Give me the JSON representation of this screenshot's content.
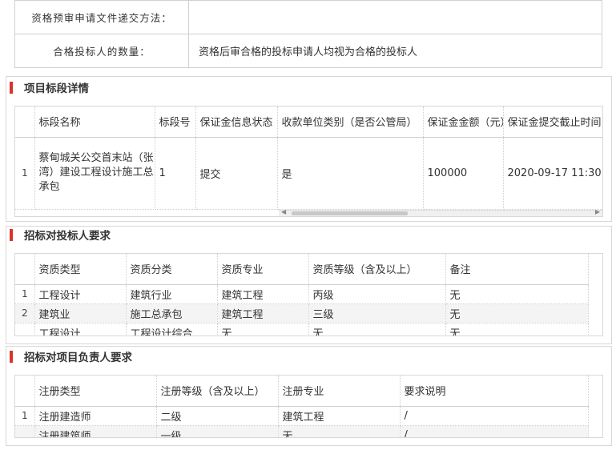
{
  "top": {
    "row1_label": "资格预审申请文件递交方法：",
    "row1_value": "",
    "row2_label": "合格投标人的数量：",
    "row2_value": "资格后审合格的投标申请人均视为合格的投标人"
  },
  "sections": {
    "segment_title": "项目标段详情",
    "bidder_title": "招标对投标人要求",
    "manager_title": "招标对项目负责人要求"
  },
  "segment": {
    "headers": [
      "标段名称",
      "标段号",
      "保证金信息状态",
      "收款单位类别（是否公管局）",
      "保证金金额（元）",
      "保证金提交截止时间"
    ],
    "rows": [
      {
        "num": "1",
        "name": "蔡甸城关公交首末站（张湾）建设工程设计施工总承包",
        "code": "1",
        "status": "提交",
        "category": "是",
        "amount": "100000",
        "deadline": "2020-09-17 11:30"
      }
    ]
  },
  "bidder": {
    "headers": [
      "资质类型",
      "资质分类",
      "资质专业",
      "资质等级（含及以上）",
      "备注"
    ],
    "rows": [
      {
        "num": "1",
        "type": "工程设计",
        "class": "建筑行业",
        "major": "建筑工程",
        "level": "丙级",
        "note": "无"
      },
      {
        "num": "2",
        "type": "建筑业",
        "class": "施工总承包",
        "major": "建筑工程",
        "level": "三级",
        "note": "无"
      },
      {
        "num": "",
        "type": "工程设计",
        "class": "工程设计综合",
        "major": "无",
        "level": "无",
        "note": "无"
      }
    ]
  },
  "manager": {
    "headers": [
      "注册类型",
      "注册等级（含及以上）",
      "注册专业",
      "要求说明"
    ],
    "rows": [
      {
        "num": "1",
        "type": "注册建造师",
        "level": "二级",
        "major": "建筑工程",
        "note": "/"
      },
      {
        "num": "",
        "type": "注册建筑师",
        "level": "一级",
        "major": "无",
        "note": "/"
      }
    ]
  },
  "colors": {
    "accent": "#d9342b",
    "border": "#d0d0d0"
  }
}
